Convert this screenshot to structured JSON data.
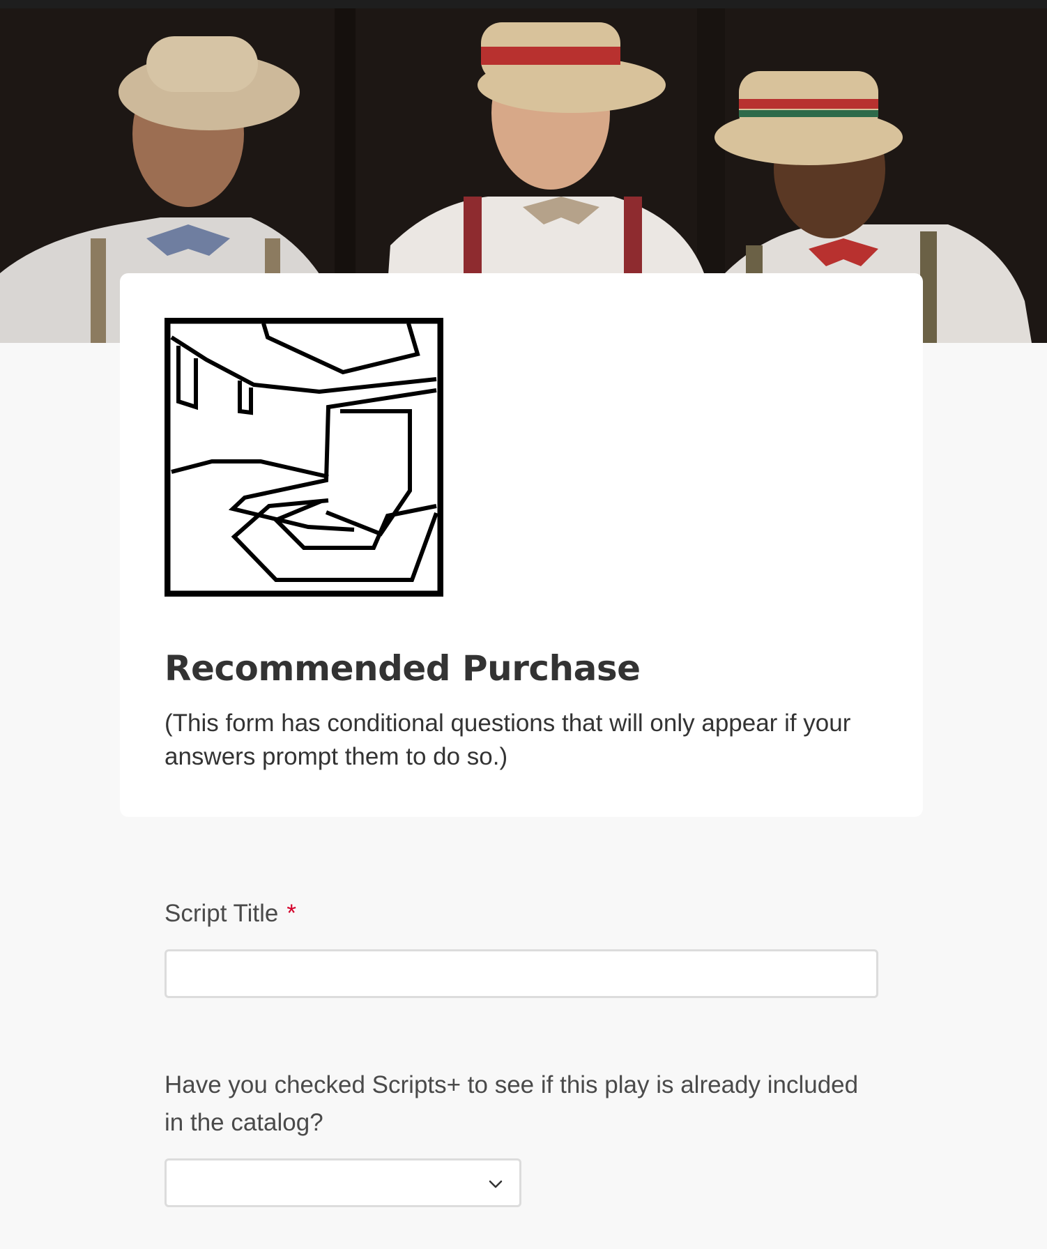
{
  "header": {
    "banner_image": "barbershop-quartet-photo",
    "logo_icon": "theatre-stage-logo-icon"
  },
  "form": {
    "title": "Recommended Purchase",
    "description": "(This form has conditional questions that will only appear if your answers prompt them to do so.)"
  },
  "questions": [
    {
      "label": "Script Title",
      "required_marker": "*",
      "value": "",
      "type": "text"
    },
    {
      "label": "Have you checked Scripts+ to see if this play is already included in the catalog?",
      "selected_value": "",
      "type": "select",
      "icon": "chevron-down-icon"
    }
  ],
  "colors": {
    "page_background": "#f8f8f8",
    "card_background": "#ffffff",
    "required": "#d4002a",
    "input_border": "#dcdcdc",
    "text": "#333333"
  }
}
